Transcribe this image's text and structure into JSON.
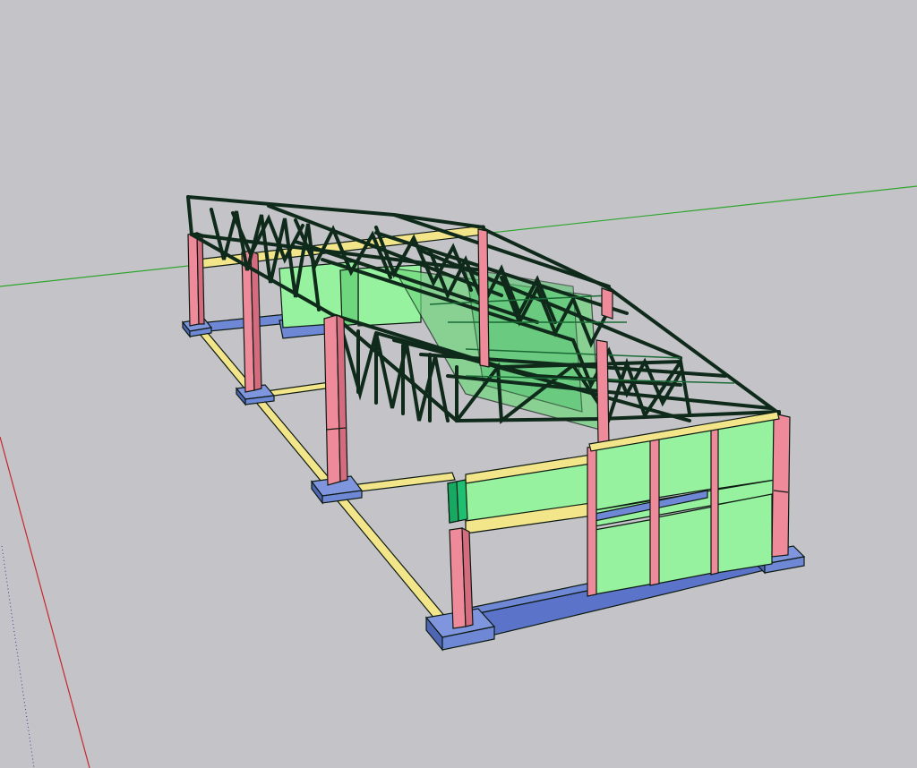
{
  "viewport": {
    "background": "#c4c4c8",
    "axes": {
      "x_axis_color": "#c8262a",
      "y_axis_color": "#2fa52f",
      "z_axis_hidden_color": "#3a3aa0"
    }
  },
  "model": {
    "colors": {
      "edge": "#0d1a12",
      "column": "#ef8a9b",
      "column_shade": "#d56b7e",
      "footing": "#6f88d6",
      "footing_shade": "#4f66b4",
      "beam": "#f3e58a",
      "beam_shade": "#d8c867",
      "wall": "#96f29e",
      "wall_shade": "#6fd77e",
      "wall_dark": "#1fbf72",
      "truss": "#0f2a1a"
    }
  }
}
